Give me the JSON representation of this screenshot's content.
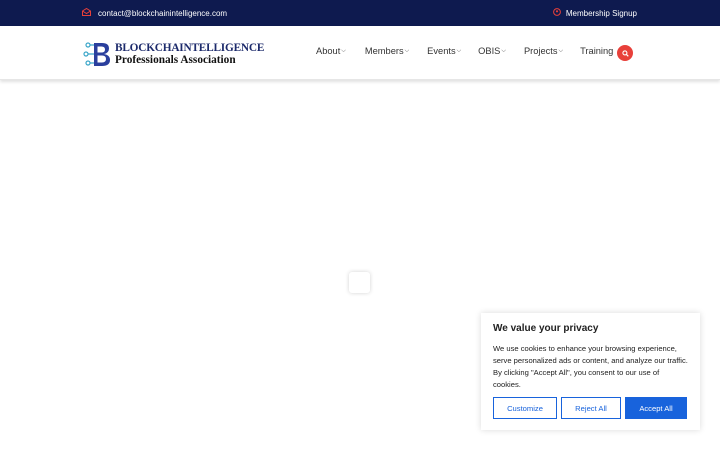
{
  "topbar": {
    "email": "contact@blockchainintelligence.com",
    "signup_label": "Membership Signup"
  },
  "logo": {
    "line1": "BLOCKCHAINTELLIGENCE",
    "line2": "Professionals Association"
  },
  "nav": {
    "items": [
      {
        "label": "About",
        "has_dropdown": true
      },
      {
        "label": "Members",
        "has_dropdown": true
      },
      {
        "label": "Events",
        "has_dropdown": true
      },
      {
        "label": "OBIS",
        "has_dropdown": true
      },
      {
        "label": "Projects",
        "has_dropdown": true
      },
      {
        "label": "Training",
        "has_dropdown": false
      }
    ]
  },
  "cookie": {
    "title": "We value your privacy",
    "body": "We use cookies to enhance your browsing experience, serve personalized ads or content, and analyze our traffic. By clicking \"Accept All\", you consent to our use of cookies.",
    "customize_label": "Customize",
    "reject_label": "Reject All",
    "accept_label": "Accept All"
  },
  "colors": {
    "topbar_bg": "#0e1a4f",
    "accent_red": "#e8403a",
    "button_blue": "#1863dc"
  }
}
